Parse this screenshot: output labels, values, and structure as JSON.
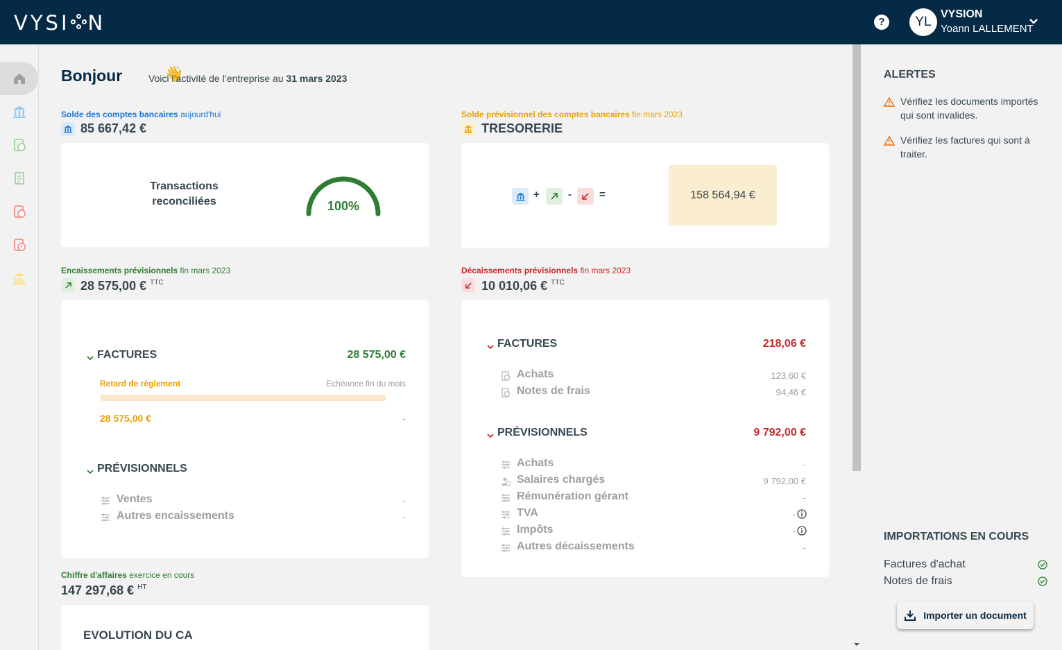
{
  "header": {
    "logo": "VYSION",
    "help_icon": "help-circle-icon",
    "avatar_initials": "YL",
    "company": "VYSION",
    "user_name": "Yoann LALLEMENT"
  },
  "sidebar": {
    "items": [
      {
        "name": "home-icon",
        "color": "#9e9e9e"
      },
      {
        "name": "bank-icon",
        "color": "#90caf9"
      },
      {
        "name": "sales-icon",
        "color": "#a5d6a7"
      },
      {
        "name": "invoice-icon",
        "color": "#a5d6a7"
      },
      {
        "name": "purchases-icon",
        "color": "#ef9a9a"
      },
      {
        "name": "expenses-icon",
        "color": "#ef9a9a"
      },
      {
        "name": "treasury-icon",
        "color": "#ffe082"
      }
    ]
  },
  "greeting": {
    "title": "Bonjour",
    "wave": "👋",
    "subtitle": "Voici l’activité de l’entreprise au",
    "date": "31 mars 2023"
  },
  "bank_balance": {
    "label": "Solde des comptes bancaires",
    "qualifier": "aujourd'hui",
    "amount": "85 667,42 €",
    "card_text_line1": "Transactions",
    "card_text_line2": "reconciliées",
    "gauge_value": "100%",
    "gauge_fraction": 1.0
  },
  "forecast_balance": {
    "label": "Solde prévisionnel des comptes bancaires",
    "qualifier": "fin mars 2023",
    "title": "TRESORERIE",
    "plus": "+",
    "minus": "-",
    "equals": "=",
    "result": "158 564,94 €"
  },
  "receipts": {
    "label": "Encaissements prévisionnels",
    "qualifier": "fin mars 2023",
    "amount": "28 575,00 €",
    "unit": "TTC",
    "factures_title": "FACTURES",
    "factures_total": "28 575,00 €",
    "late_label": "Retard de règlement",
    "due_label": "Echéance fin du mois",
    "late_value": "28 575,00 €",
    "due_value": "-",
    "late_fraction": 1.0,
    "prev_title": "PRÉVISIONNELS",
    "prev_items": [
      {
        "label": "Ventes",
        "value": "-"
      },
      {
        "label": "Autres encaissements",
        "value": "-"
      }
    ]
  },
  "disbursements": {
    "label": "Décaissements prévisionnels",
    "qualifier": "fin mars 2023",
    "amount": "10 010,06 €",
    "unit": "TTC",
    "factures_title": "FACTURES",
    "factures_total": "218,06 €",
    "factures_items": [
      {
        "label": "Achats",
        "value": "123,60 €"
      },
      {
        "label": "Notes de frais",
        "value": "94,46 €"
      }
    ],
    "prev_title": "PRÉVISIONNELS",
    "prev_total": "9 792,00 €",
    "prev_items": [
      {
        "label": "Achats",
        "value": "-"
      },
      {
        "label": "Salaires chargés",
        "value": "9 792,00 €"
      },
      {
        "label": "Rémunération gérant",
        "value": "-"
      },
      {
        "label": "TVA",
        "value": "-"
      },
      {
        "label": "Impôts",
        "value": "-"
      },
      {
        "label": "Autres décaissements",
        "value": "-"
      }
    ]
  },
  "revenue": {
    "label": "Chiffre d'affaires",
    "qualifier": "exercice en cours",
    "amount": "147 297,68 €",
    "unit": "HT",
    "card_title": "EVOLUTION DU CA"
  },
  "alerts": {
    "title": "ALERTES",
    "items": [
      "Vérifiez les documents importés qui sont invalides.",
      "Vérifiez les factures qui sont à traiter."
    ]
  },
  "imports": {
    "title": "IMPORTATIONS EN COURS",
    "items": [
      "Factures d'achat",
      "Notes de frais"
    ],
    "button": "Importer un document"
  },
  "colors": {
    "topbar": "#052a45",
    "blue": "#1976d2",
    "orange": "#e6a100",
    "green": "#2e7d32",
    "red": "#c62828"
  }
}
